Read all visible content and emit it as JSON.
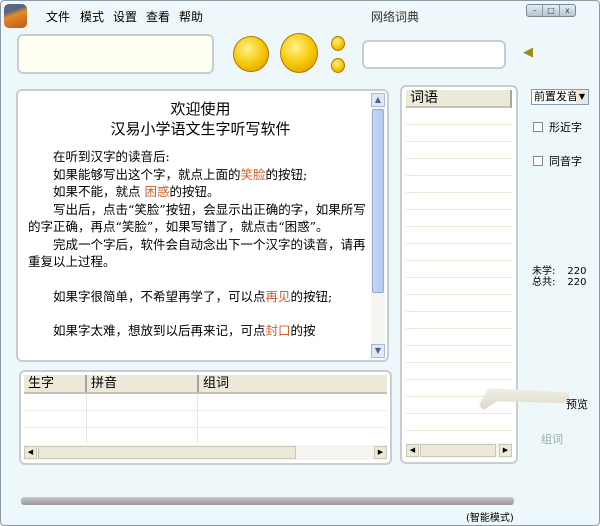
{
  "titlebar": {
    "title": "网络词典",
    "menus": [
      "文件",
      "模式",
      "设置",
      "查看",
      "帮助"
    ],
    "window_buttons": [
      "–",
      "□",
      "x"
    ]
  },
  "intro": {
    "heading1": "欢迎使用",
    "heading2": "汉易小学语文生字听写软件",
    "p1": "在听到汉字的读音后:",
    "p2a": "如果能够写出这个字，就点上面的",
    "p2b": "笑脸",
    "p2c": "的按钮;",
    "p3a": "如果不能，就点 ",
    "p3b": "困惑",
    "p3c": "的按钮。",
    "p4": "写出后，点击“笑脸”按钮，会显示出正确的字，如果所写的字正确，再点“笑脸”，如果写错了，就点击“困惑”。",
    "p5": "完成一个字后，软件会自动念出下一个汉字的读音，请再重复以上过程。",
    "p6a": "如果字很简单，不希望再学了，可以点",
    "p6b": "再见",
    "p6c": "的按钮;",
    "p7a": "如果字太难，想放到以后再来记，可点",
    "p7b": "封口",
    "p7c": "的按"
  },
  "wordlist": {
    "header": "词语"
  },
  "table": {
    "columns": [
      "生字",
      "拼音",
      "组词"
    ]
  },
  "options": {
    "pronunciation_select": "前置发音",
    "similar_shape": "形近字",
    "homophone": "同音字",
    "similar_checked": false,
    "homophone_checked": false
  },
  "stats": {
    "unlearned_label": "未学:",
    "unlearned": "220",
    "total_label": "总共:",
    "total": "220"
  },
  "misc": {
    "preview": "预览",
    "zuci": "组词",
    "mode": "(智能模式)"
  }
}
